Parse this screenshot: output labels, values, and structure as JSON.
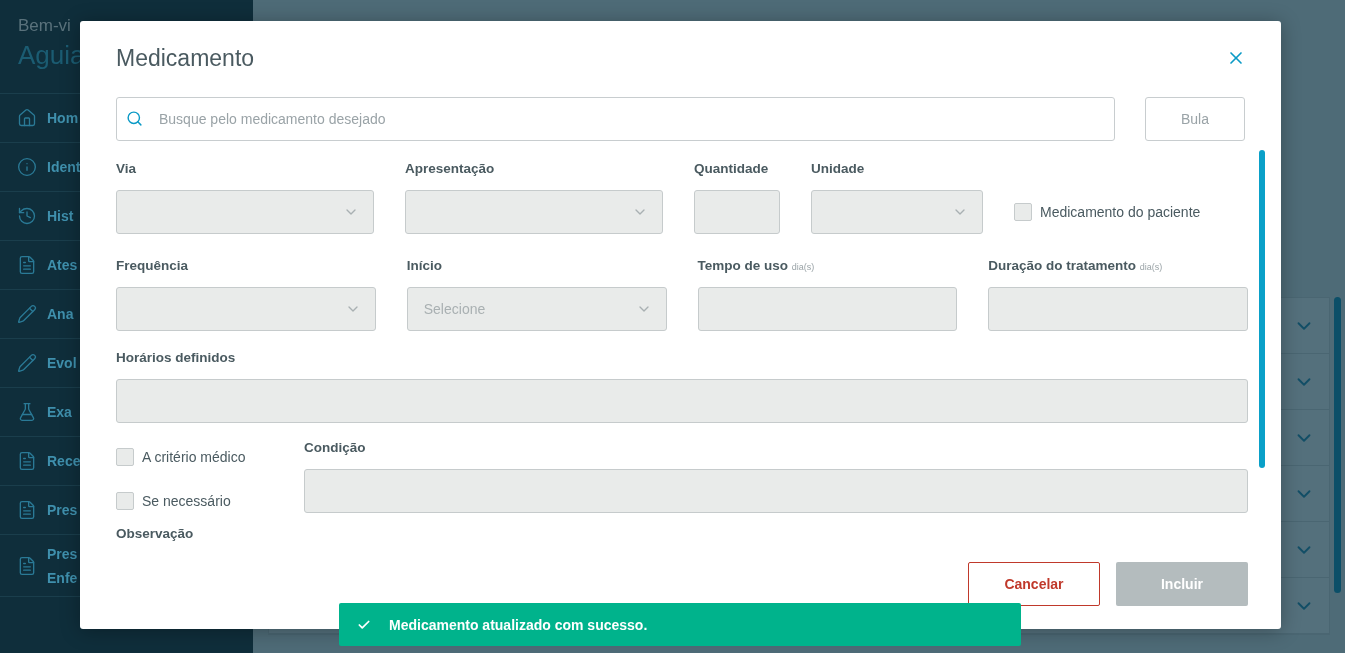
{
  "sidebar": {
    "greeting": "Bem-vi",
    "user": "Aguia",
    "items": [
      {
        "lines": [
          "Hom"
        ]
      },
      {
        "lines": [
          "Ident"
        ]
      },
      {
        "lines": [
          "Hist"
        ]
      },
      {
        "lines": [
          "Ates"
        ]
      },
      {
        "lines": [
          "Ana"
        ]
      },
      {
        "lines": [
          "Evol"
        ]
      },
      {
        "lines": [
          "Exa"
        ]
      },
      {
        "lines": [
          "Rece"
        ]
      },
      {
        "lines": [
          "Pres"
        ]
      },
      {
        "lines": [
          "Pres",
          "Enfe"
        ]
      }
    ]
  },
  "modal": {
    "title": "Medicamento",
    "search": {
      "placeholder": "Busque pelo medicamento desejado"
    },
    "bula_button": "Bula",
    "row_1": [
      {
        "kind": "select",
        "label": "Via"
      },
      {
        "kind": "select",
        "label": "Apresentação"
      },
      {
        "kind": "input",
        "label": "Quantidade"
      },
      {
        "kind": "select",
        "label": "Unidade"
      }
    ],
    "patient_medication": {
      "label": "Medicamento do paciente",
      "checked": false
    },
    "row_2": [
      {
        "kind": "select",
        "label": "Frequência"
      },
      {
        "kind": "select",
        "label": "Início",
        "placeholder": "Selecione"
      },
      {
        "kind": "input",
        "label": "Tempo de uso",
        "hint": "dia(s)"
      },
      {
        "kind": "input",
        "label": "Duração do tratamento",
        "hint": "dia(s)"
      }
    ],
    "schedules": {
      "label": "Horários definidos"
    },
    "options": [
      {
        "label": "A critério médico",
        "checked": false
      },
      {
        "label": "Se necessário",
        "checked": false
      }
    ],
    "condition": {
      "label": "Condição"
    },
    "observation": {
      "label": "Observação"
    },
    "cancel_button": "Cancelar",
    "submit_button": "Incluir"
  },
  "toast": {
    "message": "Medicamento atualizado com sucesso."
  }
}
